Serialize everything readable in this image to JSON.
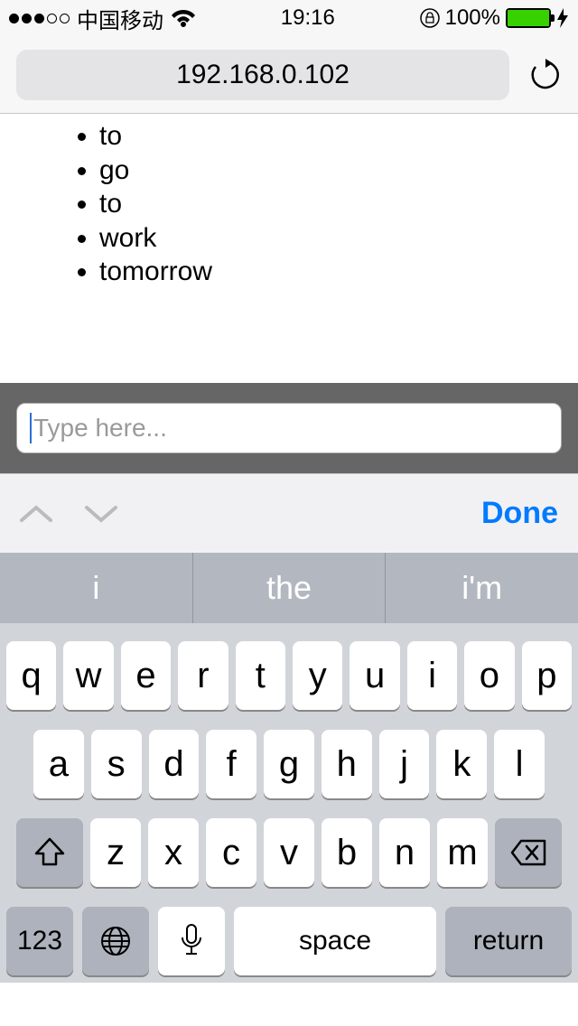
{
  "status": {
    "carrier": "中国移动",
    "time": "19:16",
    "battery_pct": "100%"
  },
  "address_bar": {
    "url": "192.168.0.102"
  },
  "page": {
    "items": [
      "to",
      "go",
      "to",
      "work",
      "tomorrow"
    ]
  },
  "textbar": {
    "placeholder": "Type here..."
  },
  "kb_accessory": {
    "done": "Done"
  },
  "suggestions": [
    "i",
    "the",
    "i'm"
  ],
  "keyboard": {
    "row1": [
      "q",
      "w",
      "e",
      "r",
      "t",
      "y",
      "u",
      "i",
      "o",
      "p"
    ],
    "row2": [
      "a",
      "s",
      "d",
      "f",
      "g",
      "h",
      "j",
      "k",
      "l"
    ],
    "row3": [
      "z",
      "x",
      "c",
      "v",
      "b",
      "n",
      "m"
    ],
    "numbers_label": "123",
    "space_label": "space",
    "return_label": "return"
  }
}
